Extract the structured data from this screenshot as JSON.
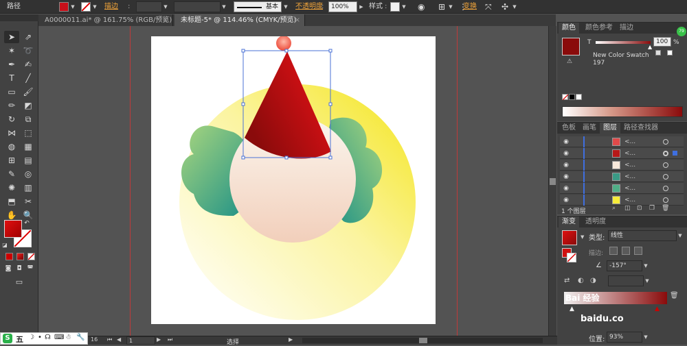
{
  "control_bar": {
    "object_type": "路径",
    "stroke_label": "描边",
    "stroke_profile": "基本",
    "opacity_label": "不透明度",
    "opacity_value": "100%",
    "style_label": "样式",
    "transform_label": "变换",
    "fill_color": "#c8101a"
  },
  "tabs": [
    {
      "label": "A0000011.ai* @ 161.75% (RGB/预览)",
      "active": false
    },
    {
      "label": "未标题-5* @ 114.46% (CMYK/预览)",
      "active": true
    }
  ],
  "tools": {
    "fill_color": "#c8101a",
    "fill_mode_gradient": "#d01818"
  },
  "color_panel": {
    "tabs": [
      "颜色",
      "颜色参考",
      "描边"
    ],
    "channel_label": "T",
    "tint_value": "100",
    "tint_unit": "%",
    "swatch_name": "New Color Swatch 197",
    "swatch_color": "#8a0b0b",
    "mini_badge": "79"
  },
  "layers_panel": {
    "tabs": [
      "色板",
      "画笔",
      "图层",
      "路径查找器"
    ],
    "rows": [
      {
        "name": "<...",
        "thumb": "#e04a4a"
      },
      {
        "name": "<...",
        "thumb": "#b81818"
      },
      {
        "name": "<...",
        "thumb": "#f7e8da"
      },
      {
        "name": "<...",
        "thumb": "#3a9a86"
      },
      {
        "name": "<...",
        "thumb": "#4fae86"
      },
      {
        "name": "<...",
        "thumb": "#f6ec3a"
      }
    ],
    "footer_count": "1 个图层"
  },
  "gradient_panel": {
    "tabs": [
      "渐变",
      "透明度"
    ],
    "type_label": "类型:",
    "type_value": "线性",
    "stroke_label": "描边:",
    "angle_value": "-157°",
    "location_label": "位置:",
    "location_value": "93%",
    "watermark": "Bai 经验",
    "watermark_url": "baidu.co"
  },
  "status_bar": {
    "zoom": "1",
    "mode": "选择"
  },
  "ime": {
    "label": "五"
  }
}
